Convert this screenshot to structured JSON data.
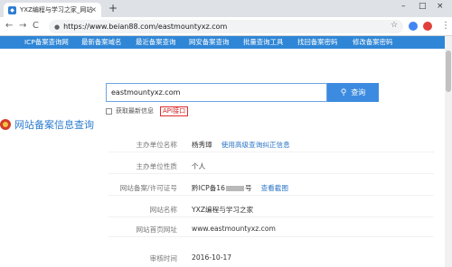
{
  "browser": {
    "tab_title": "YXZ编程与学习之家_网站备案信...",
    "tab_favicon": "shield",
    "tab_close": "×",
    "new_tab": "+",
    "url": "https://www.beian88.com/eastmountyxz.com",
    "back": "←",
    "forward": "→",
    "reload": "C",
    "minimize": "–",
    "maximize": "□",
    "close": "×",
    "star": "☆",
    "menu": "⋮"
  },
  "nav": {
    "items": [
      "ICP备案查询网",
      "最新备案域名",
      "最近备案查询",
      "网安备案查询",
      "批量查询工具",
      "找回备案密码",
      "修改备案密码"
    ]
  },
  "search": {
    "query": "eastmountyxz.com",
    "button": "查询",
    "option_label": "获取最新信息",
    "api_label": "API接口"
  },
  "page_title": "网站备案信息查询",
  "details": {
    "sponsor_label": "主办单位名称",
    "sponsor_value": "杨秀璋",
    "sponsor_link": "使用高级查询纠正信息",
    "nature_label": "主办单位性质",
    "nature_value": "个人",
    "license_label": "网站备案/许可证号",
    "license_prefix": "黔ICP备16",
    "license_suffix": "号",
    "license_link": "查看截图",
    "site_name_label": "网站名称",
    "site_name_value": "YXZ编程与学习之家",
    "homepage_label": "网站首页网址",
    "homepage_value": "www.eastmountyxz.com",
    "audit_label": "审核时间",
    "audit_value": "2016-10-17"
  },
  "colors": {
    "nav_bg": "#2f86d6",
    "accent": "#3d8be0",
    "heading": "#2c7ccf",
    "api_border": "#e02c2c"
  }
}
